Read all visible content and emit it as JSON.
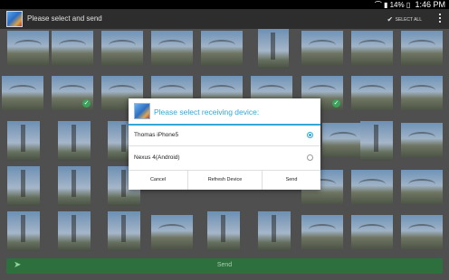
{
  "status_bar": {
    "icons": [
      "wifi-icon",
      "signal-icon",
      "battery-icon"
    ],
    "battery": "14%",
    "time": "1:46 PM"
  },
  "app_bar": {
    "title": "Please select and send",
    "select_all_label": "SELECT ALL",
    "icons": [
      "app-icon",
      "check-icon",
      "overflow-menu-icon"
    ]
  },
  "gallery": {
    "selected_items": 3
  },
  "send_bar": {
    "label": "Send",
    "icon": "send-icon",
    "color": "#2d6f3d"
  },
  "dialog": {
    "title": "Please select receiving device:",
    "accent": "#33a7d6",
    "options": [
      {
        "label": "Thomas iPhone5",
        "selected": true
      },
      {
        "label": "Nexus 4(Android)",
        "selected": false
      }
    ],
    "buttons": {
      "cancel": "Cancel",
      "refresh": "Refresh Device",
      "send": "Send"
    }
  }
}
